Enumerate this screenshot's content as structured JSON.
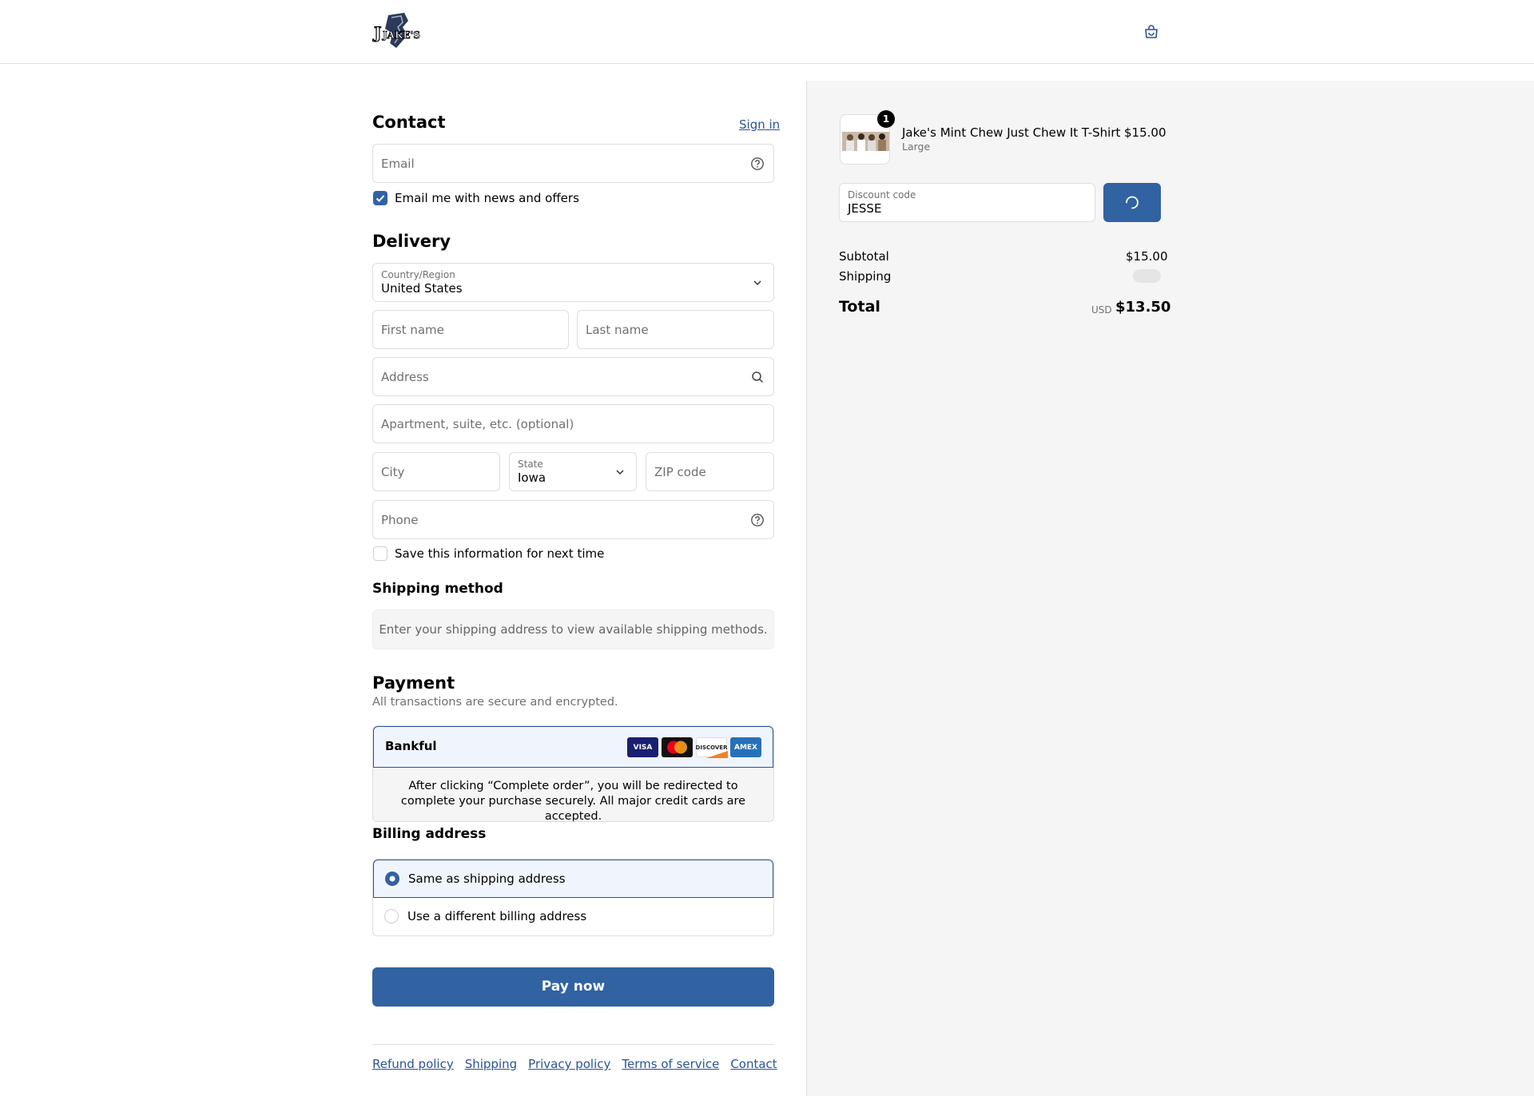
{
  "header": {
    "logo_text": "JAKE'S",
    "cart_icon": "shopping-bag-icon"
  },
  "contact": {
    "title": "Contact",
    "sign_in": "Sign in",
    "email_placeholder": "Email",
    "news_label": "Email me with news and offers",
    "news_checked": true
  },
  "delivery": {
    "title": "Delivery",
    "country_label": "Country/Region",
    "country_value": "United States",
    "first_name_placeholder": "First name",
    "last_name_placeholder": "Last name",
    "address_placeholder": "Address",
    "apartment_placeholder": "Apartment, suite, etc. (optional)",
    "city_placeholder": "City",
    "state_label": "State",
    "state_value": "Iowa",
    "zip_placeholder": "ZIP code",
    "phone_placeholder": "Phone",
    "save_info_label": "Save this information for next time",
    "save_info_checked": false
  },
  "shipping_method": {
    "title": "Shipping method",
    "message": "Enter your shipping address to view available shipping methods."
  },
  "payment": {
    "title": "Payment",
    "subtitle": "All transactions are secure and encrypted.",
    "provider": "Bankful",
    "cards": [
      "VISA",
      "MC",
      "DISCOVER",
      "AMEX"
    ],
    "redirect_message": "After clicking “Complete order”, you will be redirected to complete your purchase securely. All major credit cards are accepted."
  },
  "billing": {
    "title": "Billing address",
    "options": [
      {
        "label": "Same as shipping address",
        "selected": true
      },
      {
        "label": "Use a different billing address",
        "selected": false
      }
    ]
  },
  "pay_button": "Pay now",
  "footer": {
    "links": [
      "Refund policy",
      "Shipping",
      "Privacy policy",
      "Terms of service",
      "Contact"
    ]
  },
  "summary": {
    "item": {
      "name": "Jake's Mint Chew Just Chew It T-Shirt",
      "variant": "Large",
      "price": "$15.00",
      "quantity": "1"
    },
    "discount_label": "Discount code",
    "discount_value": "JESSE",
    "subtotal_label": "Subtotal",
    "subtotal_value": "$15.00",
    "shipping_label": "Shipping",
    "total_label": "Total",
    "currency": "USD",
    "total_value": "$13.50"
  },
  "colors": {
    "accent": "#3162a2",
    "link": "#2a5492",
    "border": "#dedede",
    "summary_bg": "#f5f5f5"
  }
}
